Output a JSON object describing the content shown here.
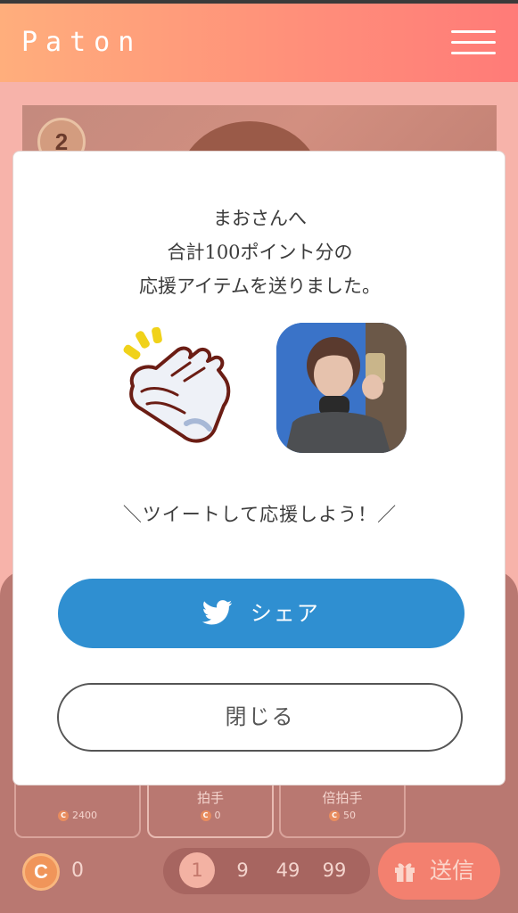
{
  "header": {
    "logo": "Paton",
    "menu_icon": "hamburger-menu-icon"
  },
  "background": {
    "rank": "2",
    "items": [
      {
        "label": "",
        "cost": "2400"
      },
      {
        "label": "拍手",
        "cost": "0"
      },
      {
        "label": "倍拍手",
        "cost": "50"
      }
    ],
    "balance": {
      "coin_symbol": "C",
      "value": "0"
    },
    "quantities": [
      "1",
      "9",
      "49",
      "99"
    ],
    "selected_quantity": "1",
    "send_label": "送信"
  },
  "modal": {
    "message_line1": "まおさんへ",
    "message_line2": "合計100ポイント分の",
    "message_line3": "応援アイテムを送りました。",
    "item_icon": "clapping-hands-icon",
    "hashtag_prompt": "＼ツイートして応援しよう！／",
    "share_label": "シェア",
    "close_label": "閉じる"
  },
  "colors": {
    "header_gradient_start": "#ffae7c",
    "header_gradient_end": "#ff7b78",
    "share_button": "#2f8fd1",
    "send_button": "#f3806f"
  }
}
